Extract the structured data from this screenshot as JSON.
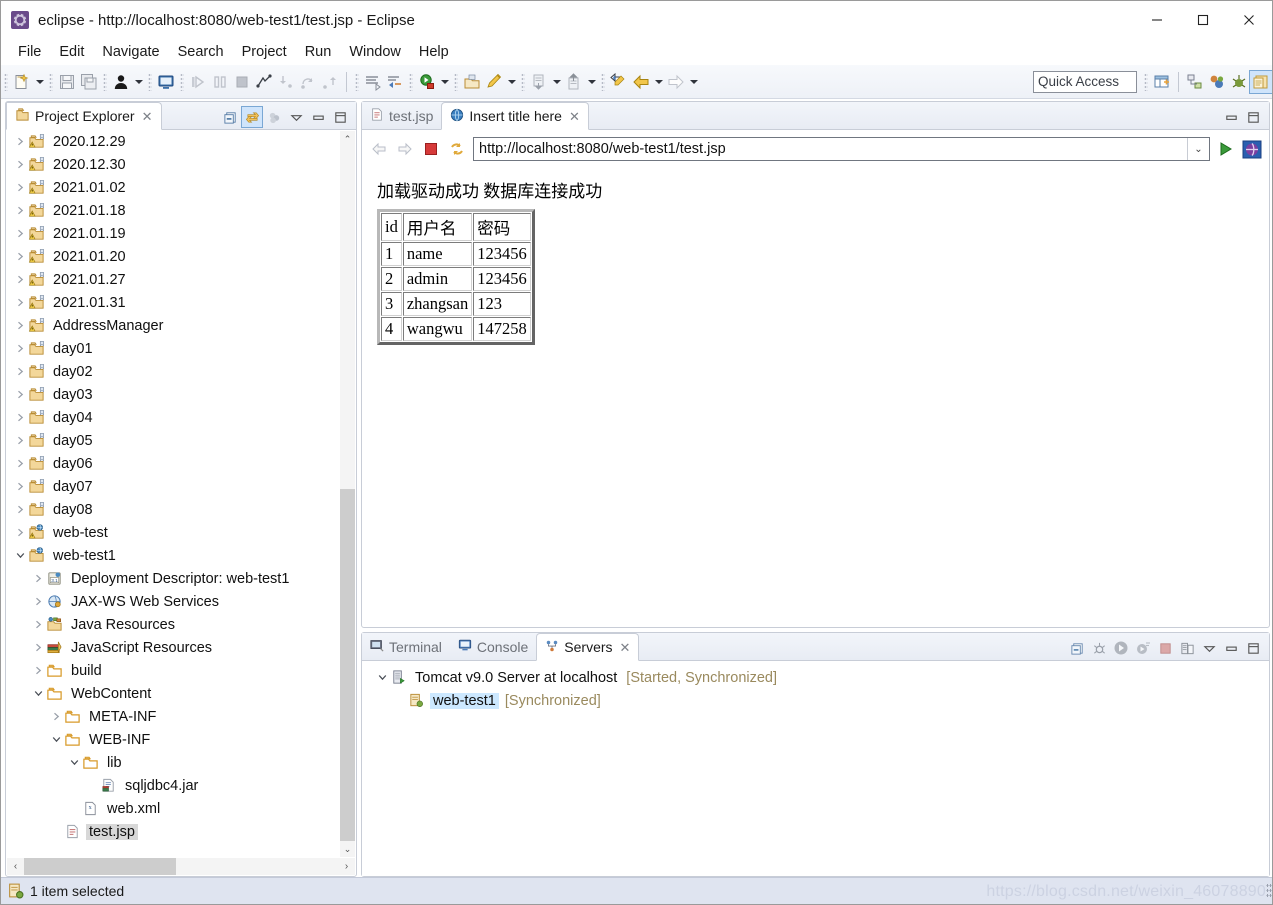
{
  "window": {
    "title": "eclipse - http://localhost:8080/web-test1/test.jsp - Eclipse",
    "app_icon": "eclipse-icon",
    "minimize_label": "—",
    "maximize_label": "□",
    "close_label": "✕"
  },
  "menubar": {
    "items": [
      {
        "label": "File"
      },
      {
        "label": "Edit"
      },
      {
        "label": "Navigate"
      },
      {
        "label": "Search"
      },
      {
        "label": "Project"
      },
      {
        "label": "Run"
      },
      {
        "label": "Window"
      },
      {
        "label": "Help"
      }
    ]
  },
  "toolbar": {
    "quick_access_placeholder": "Quick Access",
    "groups": [
      {
        "buttons": [
          {
            "icon": "new-wizard-icon",
            "dropdown": true
          }
        ]
      },
      {
        "buttons": [
          {
            "icon": "save-icon",
            "dropdown": false
          },
          {
            "icon": "save-all-icon",
            "dropdown": false
          }
        ]
      },
      {
        "buttons": [
          {
            "icon": "person-icon",
            "dropdown": true
          }
        ]
      },
      {
        "buttons": [
          {
            "icon": "console-icon",
            "dropdown": false
          }
        ]
      },
      {
        "buttons": [
          {
            "icon": "resume-icon",
            "dropdown": false
          },
          {
            "icon": "suspend-icon",
            "dropdown": false
          },
          {
            "icon": "terminate-icon",
            "dropdown": false
          },
          {
            "icon": "disconnect-icon",
            "dropdown": false
          },
          {
            "icon": "step-into-icon",
            "dropdown": false
          },
          {
            "icon": "step-over-icon",
            "dropdown": false
          },
          {
            "icon": "step-return-icon",
            "dropdown": false
          }
        ]
      },
      {
        "buttons": [
          {
            "icon": "new-css-icon",
            "dropdown": false
          },
          {
            "icon": "new-js-icon",
            "dropdown": false
          }
        ]
      },
      {
        "buttons": [
          {
            "icon": "run-icon",
            "dropdown": true
          }
        ]
      },
      {
        "buttons": [
          {
            "icon": "open-type-icon",
            "dropdown": false
          },
          {
            "icon": "search-pencil-icon",
            "dropdown": true
          }
        ]
      },
      {
        "buttons": [
          {
            "icon": "next-annotation-icon",
            "dropdown": true
          },
          {
            "icon": "prev-annotation-icon",
            "dropdown": true
          }
        ]
      },
      {
        "buttons": [
          {
            "icon": "last-edit-location-icon",
            "dropdown": false
          },
          {
            "icon": "back-icon",
            "dropdown": true
          },
          {
            "icon": "forward-icon",
            "dropdown": true
          }
        ]
      }
    ],
    "right_buttons": [
      {
        "icon": "new-perspective-icon",
        "highlighted": false
      },
      {
        "icon": "java-ee-perspective-icon",
        "highlighted": false
      },
      {
        "icon": "java-perspective-icon",
        "highlighted": false
      },
      {
        "icon": "debug-perspective-icon",
        "highlighted": false
      },
      {
        "icon": "web-perspective-icon",
        "highlighted": true
      }
    ]
  },
  "explorer": {
    "tab_label": "Project Explorer",
    "tab_icon": "project-explorer-icon",
    "tab_close": "✕",
    "tools": [
      {
        "icon": "collapse-all-icon",
        "highlighted": false
      },
      {
        "icon": "link-with-editor-icon",
        "highlighted": true
      },
      {
        "icon": "view-menu-dots-icon",
        "highlighted": false
      },
      {
        "icon": "view-menu-icon",
        "highlighted": false
      },
      {
        "icon": "minimize-icon",
        "highlighted": false
      },
      {
        "icon": "maximize-icon",
        "highlighted": false
      }
    ],
    "tree": [
      {
        "label": "2020.12.29",
        "indent": 0,
        "twisty": "collapsed",
        "icon": "java-project-warning-icon"
      },
      {
        "label": "2020.12.30",
        "indent": 0,
        "twisty": "collapsed",
        "icon": "java-project-warning-icon"
      },
      {
        "label": "2021.01.02",
        "indent": 0,
        "twisty": "collapsed",
        "icon": "java-project-warning-icon"
      },
      {
        "label": "2021.01.18",
        "indent": 0,
        "twisty": "collapsed",
        "icon": "java-project-warning-icon"
      },
      {
        "label": "2021.01.19",
        "indent": 0,
        "twisty": "collapsed",
        "icon": "java-project-warning-icon"
      },
      {
        "label": "2021.01.20",
        "indent": 0,
        "twisty": "collapsed",
        "icon": "java-project-warning-icon"
      },
      {
        "label": "2021.01.27",
        "indent": 0,
        "twisty": "collapsed",
        "icon": "java-project-warning-icon"
      },
      {
        "label": "2021.01.31",
        "indent": 0,
        "twisty": "collapsed",
        "icon": "java-project-warning-icon"
      },
      {
        "label": "AddressManager",
        "indent": 0,
        "twisty": "collapsed",
        "icon": "java-project-warning-icon"
      },
      {
        "label": "day01",
        "indent": 0,
        "twisty": "collapsed",
        "icon": "java-project-icon"
      },
      {
        "label": "day02",
        "indent": 0,
        "twisty": "collapsed",
        "icon": "java-project-icon"
      },
      {
        "label": "day03",
        "indent": 0,
        "twisty": "collapsed",
        "icon": "java-project-icon"
      },
      {
        "label": "day04",
        "indent": 0,
        "twisty": "collapsed",
        "icon": "java-project-icon"
      },
      {
        "label": "day05",
        "indent": 0,
        "twisty": "collapsed",
        "icon": "java-project-icon"
      },
      {
        "label": "day06",
        "indent": 0,
        "twisty": "collapsed",
        "icon": "java-project-icon"
      },
      {
        "label": "day07",
        "indent": 0,
        "twisty": "collapsed",
        "icon": "java-project-icon"
      },
      {
        "label": "day08",
        "indent": 0,
        "twisty": "collapsed",
        "icon": "java-project-icon"
      },
      {
        "label": "web-test",
        "indent": 0,
        "twisty": "collapsed",
        "icon": "web-project-warning-icon"
      },
      {
        "label": "web-test1",
        "indent": 0,
        "twisty": "expanded",
        "icon": "web-project-icon"
      },
      {
        "label": "Deployment Descriptor: web-test1",
        "indent": 1,
        "twisty": "collapsed",
        "icon": "deployment-descriptor-icon"
      },
      {
        "label": "JAX-WS Web Services",
        "indent": 1,
        "twisty": "collapsed",
        "icon": "jaxws-icon"
      },
      {
        "label": "Java Resources",
        "indent": 1,
        "twisty": "collapsed",
        "icon": "java-resources-icon"
      },
      {
        "label": "JavaScript Resources",
        "indent": 1,
        "twisty": "collapsed",
        "icon": "javascript-resources-icon"
      },
      {
        "label": "build",
        "indent": 1,
        "twisty": "collapsed",
        "icon": "folder-icon"
      },
      {
        "label": "WebContent",
        "indent": 1,
        "twisty": "expanded",
        "icon": "folder-icon"
      },
      {
        "label": "META-INF",
        "indent": 2,
        "twisty": "collapsed",
        "icon": "folder-icon"
      },
      {
        "label": "WEB-INF",
        "indent": 2,
        "twisty": "expanded",
        "icon": "folder-icon"
      },
      {
        "label": "lib",
        "indent": 3,
        "twisty": "expanded",
        "icon": "folder-icon"
      },
      {
        "label": "sqljdbc4.jar",
        "indent": 4,
        "twisty": "none",
        "icon": "jar-icon"
      },
      {
        "label": "web.xml",
        "indent": 3,
        "twisty": "none",
        "icon": "xml-file-icon"
      },
      {
        "label": "test.jsp",
        "indent": 2,
        "twisty": "none",
        "icon": "jsp-file-icon",
        "selected": "gray"
      }
    ],
    "hscroll": {
      "left_arrow": "‹",
      "right_arrow": "›"
    },
    "vscroll": {
      "up_arrow": "⌃",
      "down_arrow": "⌄"
    }
  },
  "editor": {
    "tabs": [
      {
        "label": "test.jsp",
        "icon": "jsp-file-icon",
        "active": false,
        "closable": false
      },
      {
        "label": "Insert title here",
        "icon": "globe-icon",
        "active": true,
        "closable": true,
        "close": "✕"
      }
    ],
    "tools": [
      {
        "icon": "minimize-icon"
      },
      {
        "icon": "maximize-icon"
      }
    ],
    "browser": {
      "back_icon": "back-arrow-icon",
      "forward_icon": "forward-arrow-icon",
      "stop_icon": "stop-icon",
      "refresh_icon": "refresh-icon",
      "url": "http://localhost:8080/web-test1/test.jsp",
      "url_chevron": "⌄",
      "go_icon": "go-play-icon",
      "open_external_icon": "open-external-browser-icon"
    },
    "page": {
      "message": "加载驱动成功 数据库连接成功",
      "table": {
        "headers": [
          "id",
          "用户名",
          "密码"
        ],
        "rows": [
          [
            "1",
            "name",
            "123456"
          ],
          [
            "2",
            "admin",
            "123456"
          ],
          [
            "3",
            "zhangsan",
            "123"
          ],
          [
            "4",
            "wangwu",
            "147258"
          ]
        ]
      }
    }
  },
  "servers": {
    "tabs": [
      {
        "label": "Terminal",
        "icon": "terminal-icon",
        "active": false,
        "closable": false
      },
      {
        "label": "Console",
        "icon": "console-icon",
        "active": false,
        "closable": false
      },
      {
        "label": "Servers",
        "icon": "servers-icon",
        "active": true,
        "closable": true,
        "close": "✕"
      }
    ],
    "tools": [
      {
        "icon": "collapse-all-icon"
      },
      {
        "icon": "debug-server-icon"
      },
      {
        "icon": "start-server-icon"
      },
      {
        "icon": "profile-server-icon"
      },
      {
        "icon": "stop-server-icon"
      },
      {
        "icon": "publish-icon"
      },
      {
        "icon": "view-menu-icon"
      },
      {
        "icon": "minimize-icon"
      },
      {
        "icon": "maximize-icon"
      }
    ],
    "tree": [
      {
        "label": "Tomcat v9.0 Server at localhost",
        "status": "[Started, Synchronized]",
        "indent": 0,
        "twisty": "expanded",
        "icon": "server-icon"
      },
      {
        "label": "web-test1",
        "status": "[Synchronized]",
        "indent": 1,
        "twisty": "none",
        "icon": "module-icon",
        "selected": "blue"
      }
    ]
  },
  "statusbar": {
    "icon": "module-icon",
    "text": "1 item selected",
    "watermark": "https://blog.csdn.net/weixin_46078890"
  },
  "colors": {
    "accent_blue": "#cce8ff",
    "selection_gray": "#d8d8d8",
    "status_text": "#9a8a5e",
    "statusbar_bg": "#dfe4f0",
    "panel_border": "#c8cdd7",
    "folder_yellow": "#f0c060"
  }
}
